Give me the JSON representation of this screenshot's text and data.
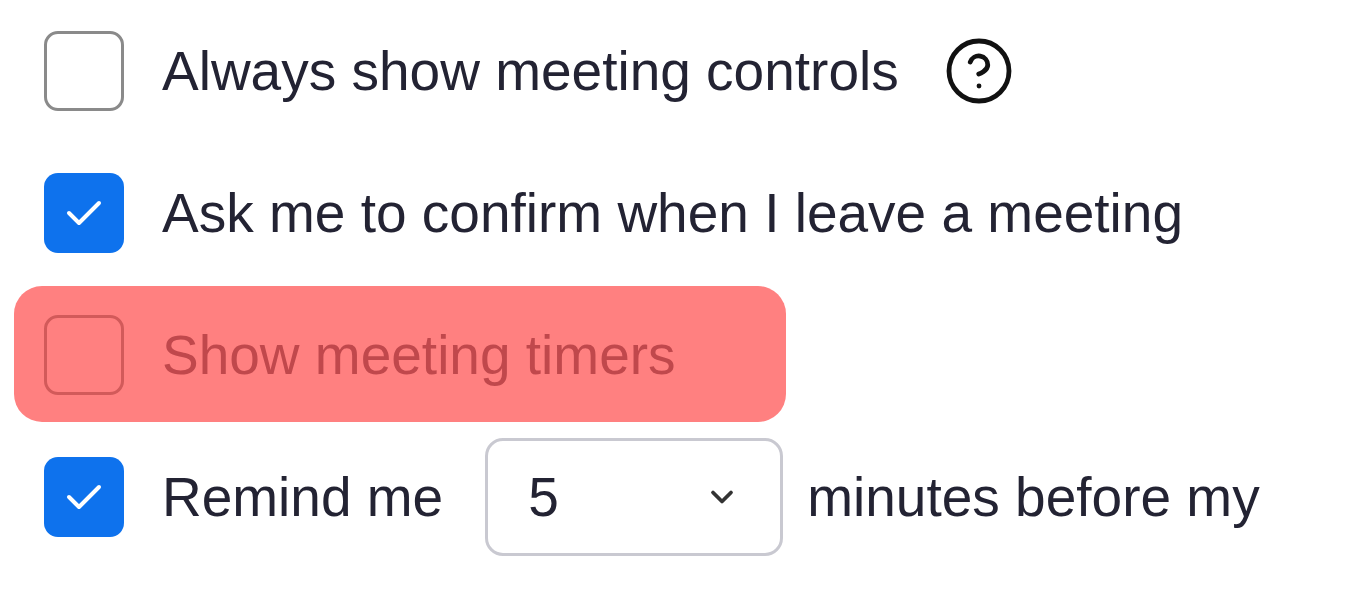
{
  "settings": [
    {
      "kind": "checkbox",
      "label": "Always show meeting controls",
      "checked": false,
      "help": true,
      "highlighted": false
    },
    {
      "kind": "checkbox",
      "label": "Ask me to confirm when I leave a meeting",
      "checked": true,
      "help": false,
      "highlighted": false
    },
    {
      "kind": "checkbox",
      "label": "Show meeting timers",
      "checked": false,
      "help": false,
      "highlighted": true
    },
    {
      "kind": "reminder",
      "label": "Remind me",
      "checked": true,
      "value": "5",
      "suffix": "minutes before my",
      "highlighted": false
    }
  ]
}
